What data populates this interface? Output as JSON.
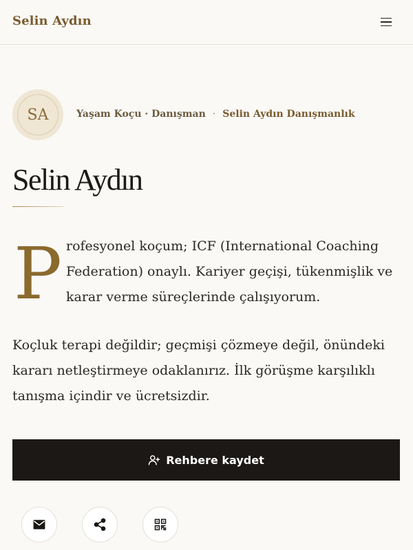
{
  "header": {
    "brand": "Selin Aydın",
    "menu_icon": "hamburger-menu-icon"
  },
  "profile": {
    "initials": "SA",
    "role": "Yaşam Koçu · Danışman",
    "separator": "·",
    "company": "Selin Aydın Danışmanlık",
    "name": "Selin Aydın"
  },
  "bio": {
    "dropcap": "P",
    "paragraph1": "rofesyonel koçum; ICF (International Coaching Federation) onaylı. Kariyer geçişi, tükenmişlik ve karar verme süreçlerinde çalışıyorum.",
    "paragraph2": "Koçluk terapi değildir; geçmişi çözmeye değil, önündeki kararı netleştirmeye odaklanırız. İlk görüşme karşılıklı tanışma içindir ve ücretsizdir."
  },
  "actions": {
    "save_contact_label": "Rehbere kaydet",
    "save_contact_icon": "add-user-icon",
    "icons": [
      "mail-icon",
      "share-icon",
      "qr-code-icon"
    ]
  },
  "colors": {
    "accent": "#8b6a2e",
    "background": "#faf9f6",
    "button_dark": "#1b1815"
  }
}
